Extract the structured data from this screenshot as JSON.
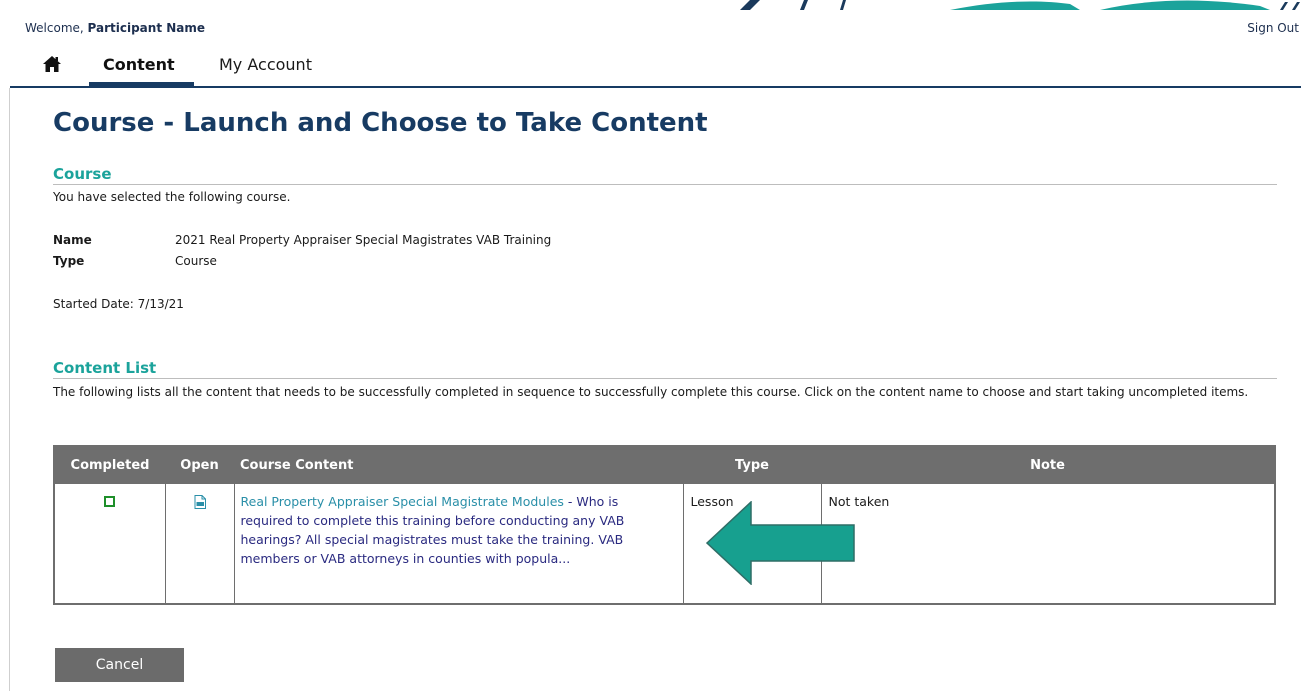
{
  "header": {
    "welcome_prefix": "Welcome, ",
    "participant_name": "Participant Name",
    "sign_out": "Sign Out"
  },
  "nav": {
    "home_icon": "home-icon",
    "tabs": [
      {
        "label": "Content",
        "active": true
      },
      {
        "label": "My Account",
        "active": false
      }
    ]
  },
  "page": {
    "title": "Course - Launch and Choose to Take Content"
  },
  "course": {
    "heading": "Course",
    "intro": "You have selected the following course.",
    "name_label": "Name",
    "name_value": "2021 Real Property Appraiser Special Magistrates VAB Training",
    "type_label": "Type",
    "type_value": "Course",
    "started": "Started Date: 7/13/21"
  },
  "content_list": {
    "heading": "Content List",
    "description": "The following lists all the content that needs to be successfully completed in sequence to successfully complete this course. Click on the content name to choose and start taking uncompleted items.",
    "columns": [
      "Completed",
      "Open",
      "Course Content",
      "Type",
      "Note"
    ],
    "rows": [
      {
        "completed_icon": "checkbox-empty-icon",
        "open_icon": "document-icon",
        "content_link": "Real Property Appraiser Special Magistrate Modules",
        "content_separator": " - ",
        "content_desc": "Who is required to complete this training before conducting any VAB hearings?   All special magistrates must take the training. VAB members or VAB attorneys in counties with popula...",
        "type": "Lesson",
        "note": "Not taken"
      }
    ]
  },
  "colors": {
    "navy": "#173b63",
    "teal": "#1ba39b",
    "header_gray": "#6e6e6e",
    "checkbox_green": "#1e8f2a",
    "link_teal": "#2a8fa8",
    "arrow_teal": "#17a08f"
  },
  "actions": {
    "cancel": "Cancel"
  }
}
